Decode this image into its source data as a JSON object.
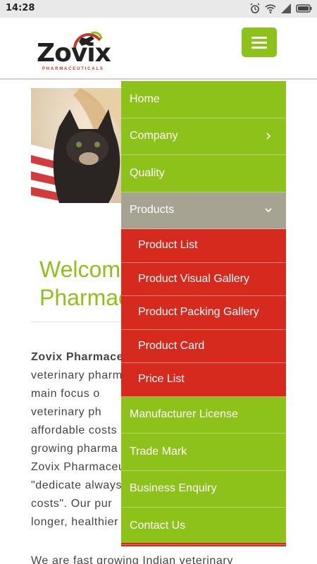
{
  "status_bar": {
    "time": "14:28",
    "icons": [
      "alarm-icon",
      "wifi-icon",
      "signal-icon",
      "battery-icon"
    ]
  },
  "header": {
    "logo_text": "Zovix",
    "logo_subtext": "PHARMACEUTICALS"
  },
  "menu": {
    "items": [
      {
        "label": "Home"
      },
      {
        "label": "Company"
      },
      {
        "label": "Quality"
      },
      {
        "label": "Products"
      }
    ],
    "products_submenu": [
      {
        "label": "Product List"
      },
      {
        "label": "Product Visual Gallery"
      },
      {
        "label": "Product Packing Gallery"
      },
      {
        "label": "Product Card"
      },
      {
        "label": "Price List"
      }
    ],
    "items_after": [
      {
        "label": "Manufacturer License"
      },
      {
        "label": "Trade Mark"
      },
      {
        "label": "Business Enquiry"
      },
      {
        "label": "Contact Us"
      }
    ]
  },
  "content": {
    "welcome_line1": "Welcome",
    "welcome_line2": "Pharmac",
    "para_lines": [
      "Zovix Pharmaceu",
      "veterinary pharm",
      "main focus o",
      "veterinary ph",
      "affordable costs",
      "growing pharma",
      "Zovix Pharmaceu",
      "\"dedicate always",
      "costs\". Our pur",
      "longer, healthier"
    ],
    "bottom_line": "We are fast growing Indian veterinary"
  },
  "colors": {
    "brand_green": "#8cc21a",
    "submenu_red": "#d62a1e",
    "active_gray": "#a7a393"
  }
}
